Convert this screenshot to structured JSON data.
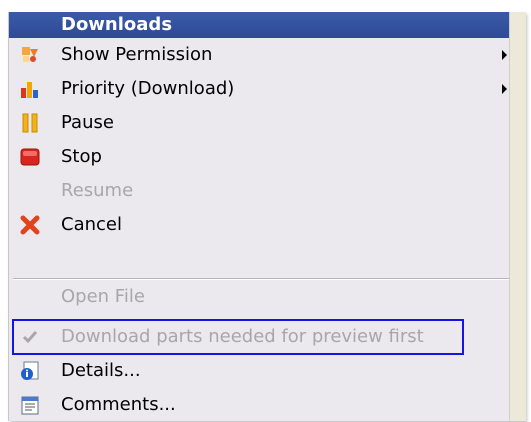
{
  "header": {
    "title": "Downloads"
  },
  "menu": {
    "items": [
      {
        "label": "Show Permission",
        "icon": "permission-icon",
        "disabled": false,
        "submenu": true
      },
      {
        "label": "Priority (Download)",
        "icon": "priority-bars-icon",
        "disabled": false,
        "submenu": true
      },
      {
        "label": "Pause",
        "icon": "pause-icon",
        "disabled": false
      },
      {
        "label": "Stop",
        "icon": "stop-icon",
        "disabled": false
      },
      {
        "label": "Resume",
        "icon": "",
        "disabled": true
      },
      {
        "label": "Cancel",
        "icon": "cancel-x-icon",
        "disabled": false
      },
      {
        "label": "Open File",
        "icon": "",
        "disabled": true
      },
      {
        "label": "Download parts needed for preview first",
        "icon": "checkmark-icon",
        "disabled": true,
        "checked": true
      },
      {
        "label": "Details...",
        "icon": "details-info-icon",
        "disabled": false
      },
      {
        "label": "Comments...",
        "icon": "comments-notepad-icon",
        "disabled": false
      }
    ]
  },
  "colors": {
    "header_bg": "#3a5aa8",
    "menu_bg": "#ebe9ed",
    "disabled_text": "#a8a6ad",
    "highlight_border": "#1414e6"
  }
}
